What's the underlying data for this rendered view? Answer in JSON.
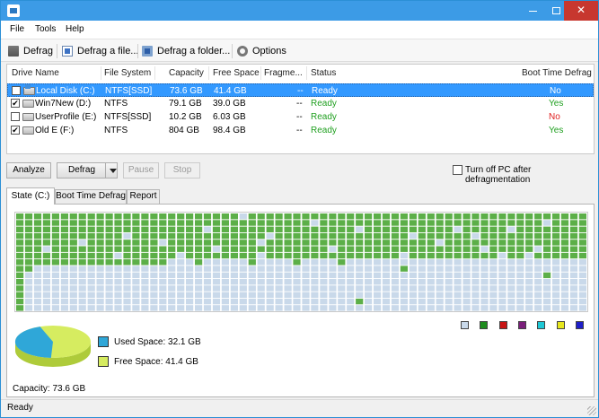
{
  "window": {
    "title": ""
  },
  "menu": [
    "File",
    "Tools",
    "Help"
  ],
  "toolbar": {
    "defrag": "Defrag",
    "defrag_file": "Defrag a file...",
    "defrag_folder": "Defrag a folder...",
    "options": "Options"
  },
  "drives": {
    "headers": [
      "Drive Name",
      "File System",
      "Capacity",
      "Free Space",
      "Fragme...",
      "Status",
      "Boot Time Defrag"
    ],
    "rows": [
      {
        "name": "Local Disk (C:)",
        "fs": "NTFS[SSD]",
        "capacity": "73.6 GB",
        "free": "41.4 GB",
        "frag": "--",
        "status": "Ready",
        "boot": "No",
        "checked": false,
        "selected": true,
        "system": true
      },
      {
        "name": "Win7New (D:)",
        "fs": "NTFS",
        "capacity": "79.1 GB",
        "free": "39.0 GB",
        "frag": "--",
        "status": "Ready",
        "boot": "Yes",
        "checked": true,
        "selected": false,
        "system": false
      },
      {
        "name": "UserProfile (E:)",
        "fs": "NTFS[SSD]",
        "capacity": "10.2 GB",
        "free": "6.03 GB",
        "frag": "--",
        "status": "Ready",
        "boot": "No",
        "checked": false,
        "selected": false,
        "system": false
      },
      {
        "name": "Old E (F:)",
        "fs": "NTFS",
        "capacity": "804 GB",
        "free": "98.4 GB",
        "frag": "--",
        "status": "Ready",
        "boot": "Yes",
        "checked": true,
        "selected": false,
        "system": false
      }
    ]
  },
  "actions": {
    "analyze": "Analyze",
    "defrag": "Defrag",
    "pause": "Pause",
    "stop": "Stop",
    "turn_off": "Turn off PC after defragmentation",
    "turn_off_checked": false
  },
  "tabs": [
    "State (C:)",
    "Boot Time Defrag",
    "Report"
  ],
  "state": {
    "legend_colors": [
      "#c9d9ea",
      "#1e8c1e",
      "#c81414",
      "#7a1e7a",
      "#1ec8d6",
      "#e6e61e",
      "#1e1ec8"
    ],
    "used_label": "Used Space: 32.1 GB",
    "free_label": "Free Space: 41.4 GB",
    "capacity_label": "Capacity: 73.6 GB",
    "used_color": "#2fa7d8",
    "free_color": "#d6ec60",
    "used_fraction": 0.436,
    "map_used_color": "#5caf48",
    "map_free_color": "#c9d9ea"
  },
  "status": {
    "text": "Ready"
  },
  "colors": {
    "accent": "#3c9be6",
    "selection": "#3399ff",
    "ready": "#1f9f1f",
    "no": "#e02020"
  }
}
